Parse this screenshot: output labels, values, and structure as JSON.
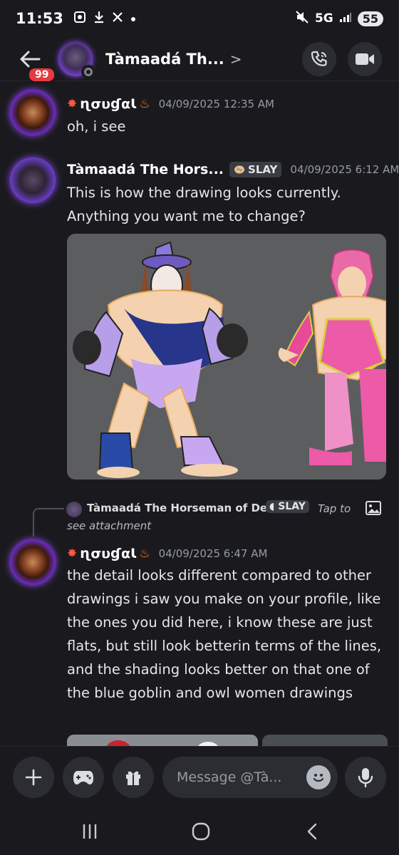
{
  "status_bar": {
    "time": "11:53",
    "network": "5G",
    "battery": "55"
  },
  "header": {
    "unread_count": "99",
    "title": "Tàmaadá Th...",
    "chevron": ">"
  },
  "messages": [
    {
      "author": "ɳσυɠαƖ",
      "timestamp": "04/09/2025 12:35 AM",
      "text": "oh, i see"
    },
    {
      "author": "Tàmaadá The Hors...",
      "tag": "SLAY",
      "timestamp": "04/09/2025 6:12 AM",
      "text": "This is how the drawing looks currently. Anything you want me to change?"
    },
    {
      "author": "ɳσυɠαƖ",
      "timestamp": "04/09/2025 6:47 AM",
      "text": "the detail looks different compared to other drawings i saw you make on your profile, like the ones you did here, i know these are just flats, but still look betterin terms of the lines, and the shading looks better on that one of the blue goblin and owl women drawings"
    }
  ],
  "reply": {
    "author": "Tàmaadá The Horseman of Death",
    "tag": "SLAY",
    "tap_text": "Tap to",
    "see_text": "see attachment"
  },
  "composer": {
    "placeholder": "Message @Tà..."
  },
  "colors": {
    "background": "#1a1a1e",
    "badge_red": "#e53b3f",
    "avatar_glow": "#8c4cff",
    "timestamp": "#949ba4"
  }
}
